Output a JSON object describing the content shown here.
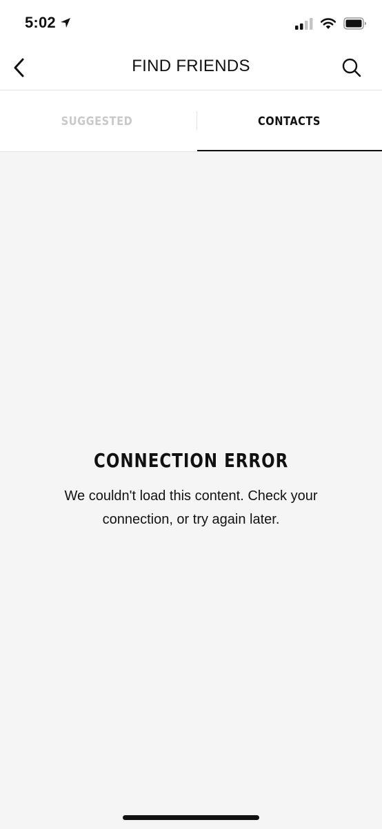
{
  "status_bar": {
    "time": "5:02",
    "location_icon": "location-arrow-icon",
    "signal_icon": "cellular-signal-icon",
    "wifi_icon": "wifi-icon",
    "battery_icon": "battery-icon"
  },
  "nav": {
    "back_icon": "chevron-left-icon",
    "title": "FIND FRIENDS",
    "search_icon": "search-icon"
  },
  "tabs": [
    {
      "label": "SUGGESTED",
      "active": false
    },
    {
      "label": "CONTACTS",
      "active": true
    }
  ],
  "error": {
    "title": "CONNECTION ERROR",
    "message": "We couldn't load this content. Check your connection, or try again later."
  },
  "colors": {
    "background": "#f5f5f5",
    "text": "#111111",
    "inactive_tab": "#c9c9c9"
  }
}
